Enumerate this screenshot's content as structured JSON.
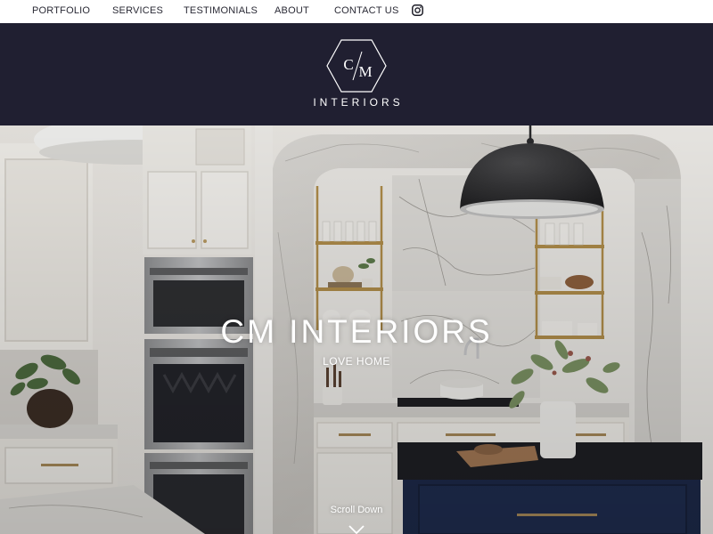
{
  "nav": {
    "items": [
      {
        "label": "PORTFOLIO"
      },
      {
        "label": "SERVICES"
      },
      {
        "label": "TESTIMONIALS"
      },
      {
        "label": "ABOUT"
      },
      {
        "label": "CONTACT US"
      }
    ],
    "social_icon": "instagram-icon"
  },
  "header": {
    "background": "#201f31",
    "logo": {
      "monogram_left": "C",
      "monogram_right": "M",
      "wordmark": "INTERIORS"
    }
  },
  "hero": {
    "title": "CM INTERIORS",
    "subtitle": "LOVE HOME",
    "scroll_label": "Scroll Down",
    "scroll_icon": "chevron-down-icon"
  },
  "colors": {
    "nav_text": "#2a2a35",
    "header_bg": "#201f31",
    "hero_text": "#ffffff"
  }
}
